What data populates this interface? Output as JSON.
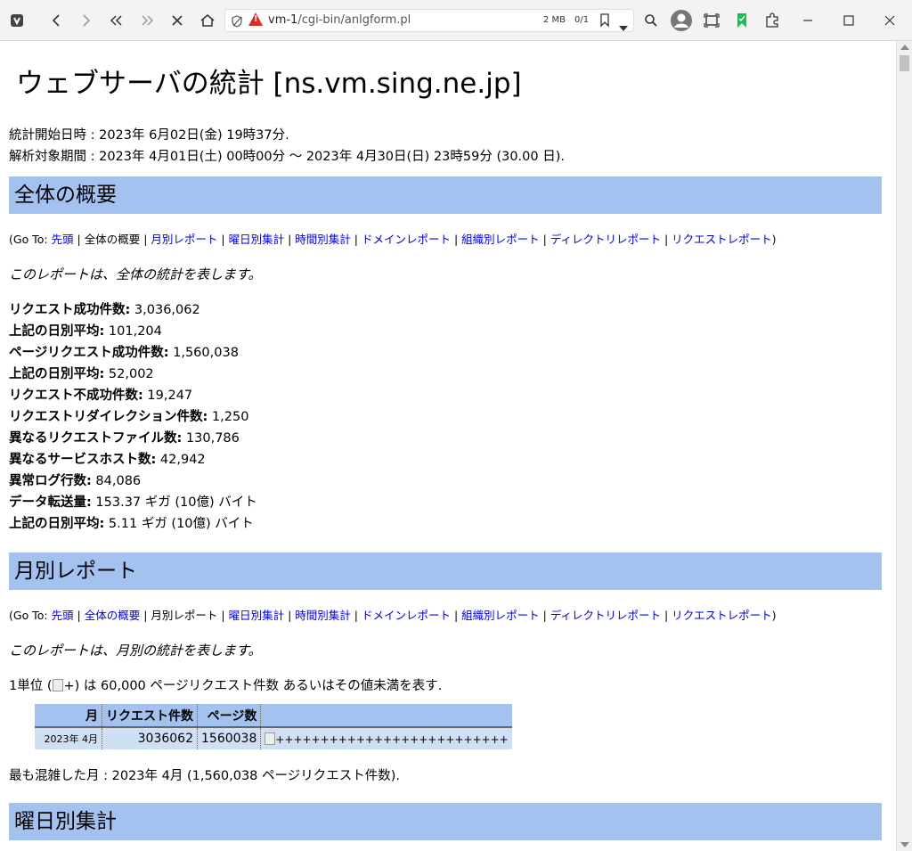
{
  "browser": {
    "url_host": "vm-1",
    "url_path": "/cgi-bin/anlgform.pl",
    "memory": "2 MB",
    "find_count": "0/1",
    "colors": {
      "accent": "#d93025",
      "bookmark": "#1db954"
    }
  },
  "page": {
    "title": "ウェブサーバの統計 [ns.vm.sing.ne.jp]",
    "meta": {
      "start_line": "統計開始日時 : 2023年 6月02日(金) 19時37分.",
      "period_line": "解析対象期間 : 2023年 4月01日(土) 00時00分 〜 2023年 4月30日(日) 23時59分 (30.00 日)."
    },
    "goto": {
      "prefix": "(Go To: ",
      "suffix": ")",
      "sep": " | ",
      "items": [
        "先頭",
        "全体の概要",
        "月別レポート",
        "曜日別集計",
        "時間別集計",
        "ドメインレポート",
        "組織別レポート",
        "ディレクトリレポート",
        "リクエストレポート"
      ]
    },
    "summary": {
      "heading": "全体の概要",
      "desc": "このレポートは、全体の統計を表します。",
      "stats": [
        {
          "label": "リクエスト成功件数:",
          "value": " 3,036,062"
        },
        {
          "label": "上記の日別平均:",
          "value": " 101,204"
        },
        {
          "label": "ページリクエスト成功件数:",
          "value": " 1,560,038"
        },
        {
          "label": "上記の日別平均:",
          "value": " 52,002"
        },
        {
          "label": "リクエスト不成功件数:",
          "value": " 19,247"
        },
        {
          "label": "リクエストリダイレクション件数:",
          "value": " 1,250"
        },
        {
          "label": "異なるリクエストファイル数:",
          "value": " 130,786"
        },
        {
          "label": "異なるサービスホスト数:",
          "value": " 42,942"
        },
        {
          "label": "異常ログ行数:",
          "value": " 84,086"
        },
        {
          "label": "データ転送量:",
          "value": " 153.37 ギガ (10億) バイト"
        },
        {
          "label": "上記の日別平均:",
          "value": " 5.11 ギガ (10億) バイト"
        }
      ]
    },
    "monthly": {
      "heading": "月別レポート",
      "desc": "このレポートは、月別の統計を表します。",
      "unit_before": "1単位 (",
      "unit_img_alt": "+",
      "unit_after": ") は 60,000 ページリクエスト件数 あるいはその値未満を表す.",
      "table": {
        "headers": [
          "月",
          "リクエスト件数",
          "ページ数",
          ""
        ],
        "rows": [
          {
            "month": "2023年 4月",
            "requests": "3036062",
            "pages": "1560038",
            "bar": "++++++++++++++++++++++++++"
          }
        ]
      },
      "busiest": "最も混雑した月 : 2023年 4月 (1,560,038 ページリクエスト件数)."
    },
    "weekday": {
      "heading": "曜日別集計"
    }
  }
}
